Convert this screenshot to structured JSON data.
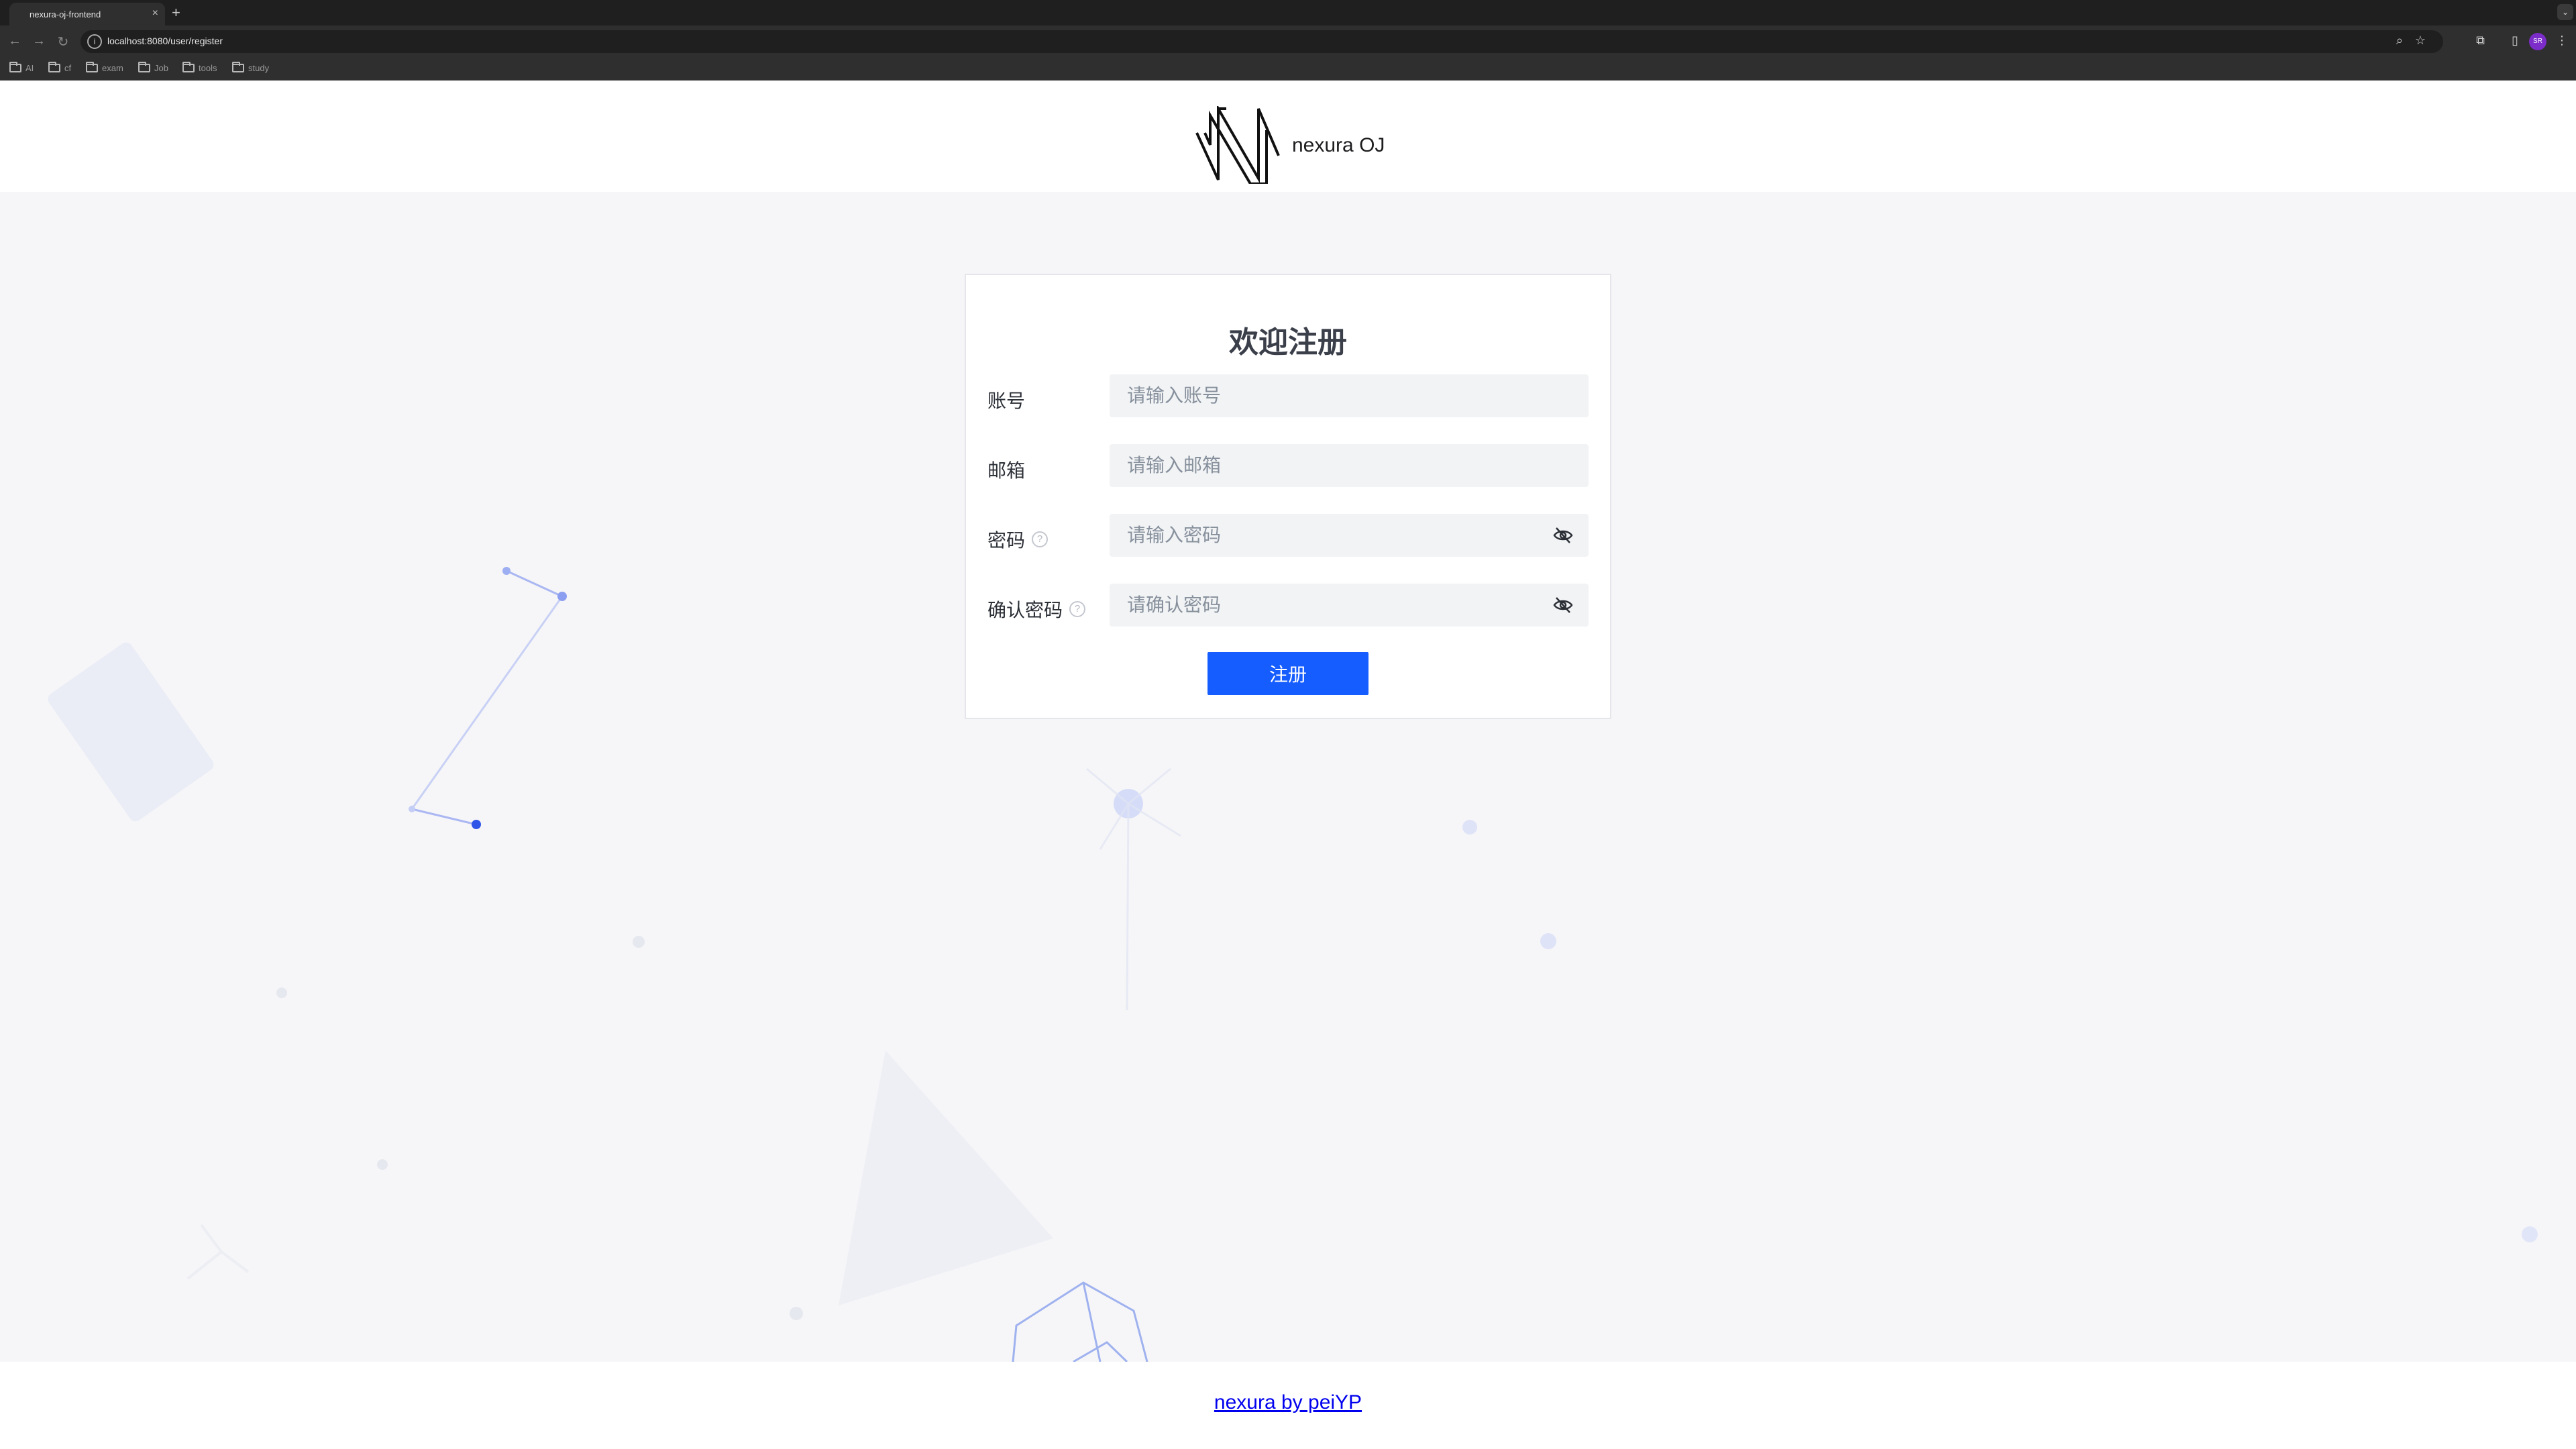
{
  "browser": {
    "tab_title": "nexura-oj-frontend",
    "tab_close": "×",
    "new_tab": "+",
    "url": "localhost:8080/user/register",
    "bookmarks": [
      {
        "label": "AI"
      },
      {
        "label": "cf"
      },
      {
        "label": "exam"
      },
      {
        "label": "Job"
      },
      {
        "label": "tools"
      },
      {
        "label": "study"
      }
    ],
    "profile_initials": "SR"
  },
  "header": {
    "app_name": "nexura OJ"
  },
  "form": {
    "title": "欢迎注册",
    "fields": [
      {
        "label": "账号",
        "placeholder": "请输入账号"
      },
      {
        "label": "邮箱",
        "placeholder": "请输入邮箱"
      },
      {
        "label": "密码",
        "placeholder": "请输入密码",
        "help": "?"
      },
      {
        "label": "确认密码",
        "placeholder": "请确认密码",
        "help": "?"
      }
    ],
    "submit_label": "注册"
  },
  "footer": {
    "link_text": "nexura by peiYP"
  },
  "colors": {
    "primary": "#165dff",
    "background": "#f6f6f8",
    "input_bg": "#f2f3f5"
  }
}
